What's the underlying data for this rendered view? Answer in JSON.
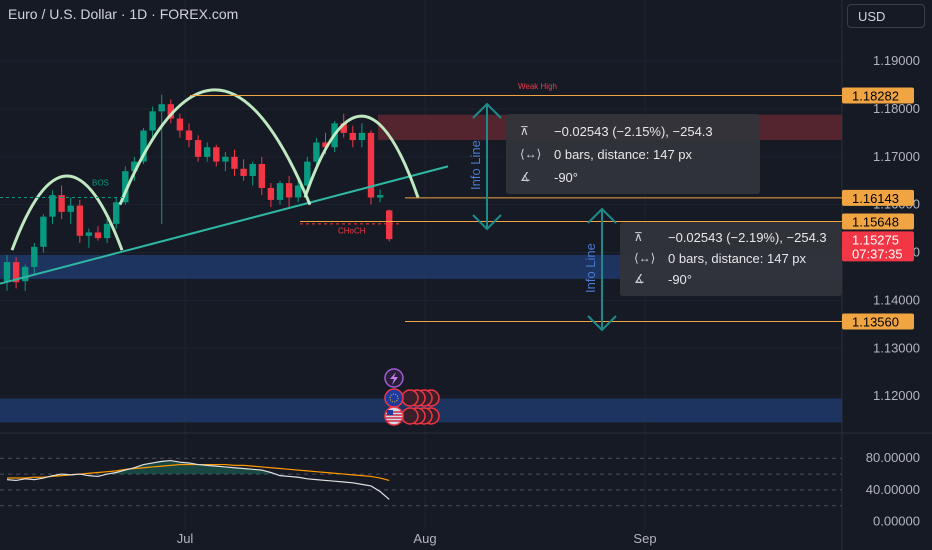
{
  "header": {
    "title": "Euro / U.S. Dollar · 1D · FOREX.com",
    "currency": "USD"
  },
  "colors": {
    "up": "#089981",
    "down": "#f23645",
    "arc": "#c8f2c8",
    "trend": "#2fb7a4",
    "level": "#f0a542",
    "measure": "#1e8a8a",
    "zone_blue": "#1e3a6b",
    "zone_red": "#6b2a33",
    "rsi": "#e0e0e0",
    "rsi_ma": "#ff9800",
    "label_orange": "#f0a542",
    "last_price": "#f23645"
  },
  "chart_data": {
    "type": "candlestick",
    "symbol": "EURUSD",
    "timeframe": "1D",
    "ylim": [
      1.1125,
      1.1965
    ],
    "y_ticks": [
      "1.19000",
      "1.18000",
      "1.17000",
      "1.16000",
      "1.15000",
      "1.14000",
      "1.13000",
      "1.12000"
    ],
    "x_ticks": [
      "Jul",
      "Aug",
      "Sep"
    ],
    "candles": [
      [
        1.144,
        1.1495,
        1.142,
        1.148
      ],
      [
        1.148,
        1.149,
        1.1425,
        1.1438
      ],
      [
        1.144,
        1.1475,
        1.142,
        1.147
      ],
      [
        1.147,
        1.152,
        1.1455,
        1.1512
      ],
      [
        1.1512,
        1.158,
        1.15,
        1.1575
      ],
      [
        1.1575,
        1.163,
        1.156,
        1.162
      ],
      [
        1.162,
        1.164,
        1.157,
        1.1585
      ],
      [
        1.1585,
        1.1615,
        1.156,
        1.1598
      ],
      [
        1.1598,
        1.161,
        1.152,
        1.1535
      ],
      [
        1.1535,
        1.155,
        1.151,
        1.1542
      ],
      [
        1.1542,
        1.1555,
        1.1525,
        1.153
      ],
      [
        1.153,
        1.157,
        1.152,
        1.156
      ],
      [
        1.156,
        1.1615,
        1.155,
        1.1605
      ],
      [
        1.1605,
        1.168,
        1.16,
        1.167
      ],
      [
        1.167,
        1.17,
        1.165,
        1.169
      ],
      [
        1.169,
        1.176,
        1.1685,
        1.1755
      ],
      [
        1.1755,
        1.1805,
        1.174,
        1.1795
      ],
      [
        1.1795,
        1.183,
        1.156,
        1.181
      ],
      [
        1.181,
        1.182,
        1.177,
        1.178
      ],
      [
        1.178,
        1.179,
        1.174,
        1.1755
      ],
      [
        1.1755,
        1.177,
        1.172,
        1.1735
      ],
      [
        1.1735,
        1.1745,
        1.169,
        1.17
      ],
      [
        1.17,
        1.173,
        1.169,
        1.172
      ],
      [
        1.172,
        1.1725,
        1.168,
        1.169
      ],
      [
        1.169,
        1.171,
        1.167,
        1.17
      ],
      [
        1.17,
        1.1715,
        1.166,
        1.1675
      ],
      [
        1.1675,
        1.1695,
        1.165,
        1.166
      ],
      [
        1.166,
        1.169,
        1.164,
        1.1685
      ],
      [
        1.1685,
        1.17,
        1.162,
        1.1635
      ],
      [
        1.1635,
        1.1645,
        1.1595,
        1.161
      ],
      [
        1.161,
        1.165,
        1.16,
        1.1645
      ],
      [
        1.1645,
        1.166,
        1.1595,
        1.1615
      ],
      [
        1.1615,
        1.165,
        1.1605,
        1.164
      ],
      [
        1.164,
        1.17,
        1.163,
        1.169
      ],
      [
        1.169,
        1.174,
        1.168,
        1.173
      ],
      [
        1.173,
        1.175,
        1.1705,
        1.172
      ],
      [
        1.172,
        1.1775,
        1.171,
        1.177
      ],
      [
        1.177,
        1.179,
        1.174,
        1.175
      ],
      [
        1.175,
        1.1765,
        1.172,
        1.1735
      ],
      [
        1.1735,
        1.177,
        1.172,
        1.175
      ],
      [
        1.175,
        1.1755,
        1.16,
        1.1615
      ],
      [
        1.1615,
        1.1632,
        1.1605,
        1.162
      ],
      [
        1.1588,
        1.159,
        1.1523,
        1.1528
      ]
    ],
    "levels": [
      {
        "price": 1.18282,
        "label": "1.18282"
      },
      {
        "price": 1.16143,
        "label": "1.16143"
      },
      {
        "price": 1.15648,
        "label": "1.15648"
      },
      {
        "price": 1.1356,
        "label": "1.13560"
      }
    ],
    "last_price": {
      "price": 1.15275,
      "label": "1.15275",
      "countdown": "07:37:35"
    },
    "annotations": {
      "weak_high": "Weak High",
      "bos": "BOS",
      "choch": "CHoCH",
      "info_line": "Info Line"
    },
    "info_boxes": [
      {
        "delta": "−0.02543 (−2.15%), −254.3",
        "bars": "0 bars, distance: 147 px",
        "angle": "-90°"
      },
      {
        "delta": "−0.02543 (−2.19%), −254.3",
        "bars": "0 bars, distance: 147 px",
        "angle": "-90°"
      }
    ],
    "oscillator": {
      "ticks": [
        "80.00000",
        "40.00000",
        "0.00000"
      ],
      "ylim": [
        -8,
        108
      ],
      "line": [
        53,
        52,
        54,
        53,
        55,
        58,
        60,
        59,
        60,
        58,
        57,
        60,
        62,
        65,
        68,
        72,
        74,
        76,
        77,
        75,
        74,
        72,
        71,
        70,
        69,
        68,
        67,
        66,
        65,
        62,
        58,
        57,
        56,
        54,
        53,
        52,
        51,
        50,
        49,
        47,
        45,
        38,
        28
      ],
      "ma": [
        55,
        55,
        55,
        56,
        56,
        57,
        58,
        59,
        60,
        61,
        62,
        63,
        64,
        66,
        67,
        68,
        69,
        70,
        71,
        72,
        72,
        72,
        72,
        72,
        72,
        71,
        71,
        70,
        69,
        68,
        67,
        66,
        65,
        64,
        63,
        62,
        61,
        60,
        59,
        58,
        57,
        55,
        52
      ]
    }
  }
}
